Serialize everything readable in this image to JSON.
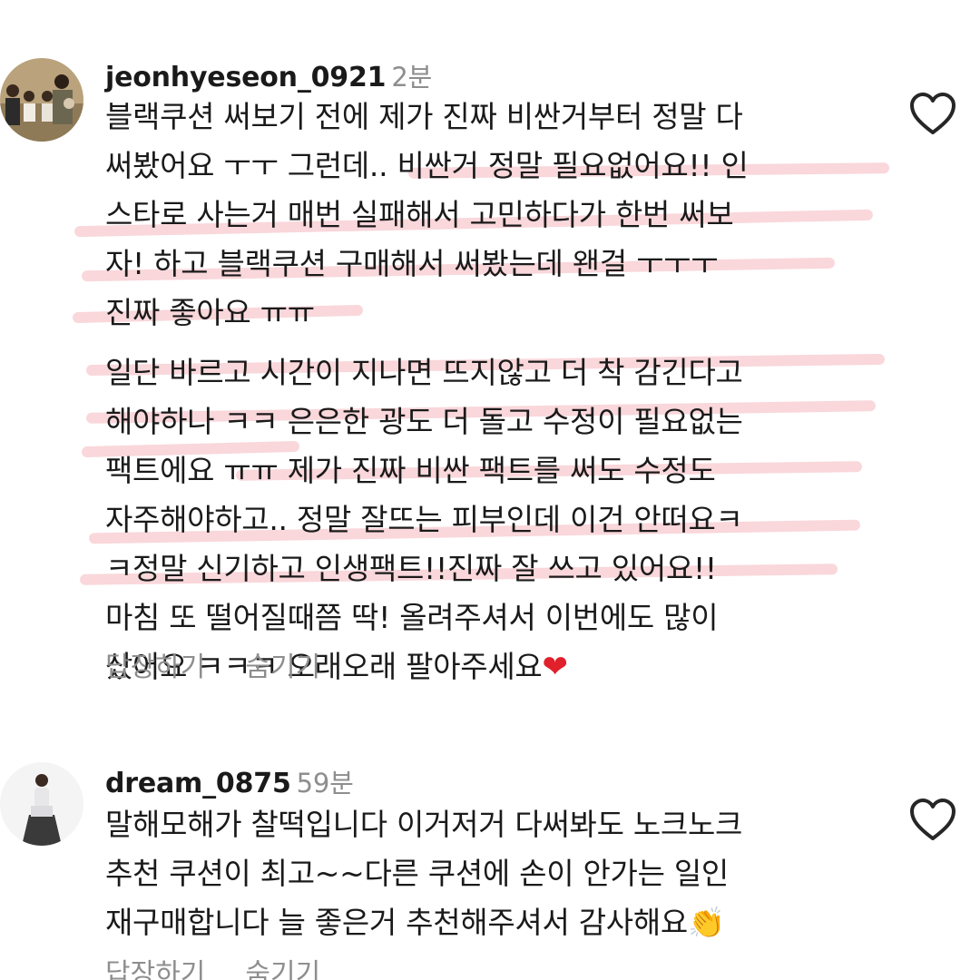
{
  "comments": [
    {
      "username": "jeonhyeseon_0921",
      "time": "2분",
      "lines": [
        "블랙쿠션 써보기 전에 제가 진짜 비싼거부터 정말 다",
        "써봤어요 ㅜㅜ 그런데.. 비싼거 정말 필요없어요!! 인",
        "스타로 사는거 매번 실패해서 고민하다가 한번 써보",
        "자! 하고 블랙쿠션 구매해서 써봤는데 왠걸 ㅜㅜㅜ",
        "진짜 좋아요 ㅠㅠ",
        "일단 바르고 시간이 지나면 뜨지않고 더 착 감긴다고",
        "해야하나 ㅋㅋ 은은한 광도 더 돌고 수정이 필요없는",
        "팩트에요 ㅠㅠ 제가 진짜 비싼 팩트를 써도 수정도",
        "자주해야하고.. 정말 잘뜨는 피부인데 이건 안떠요ㅋ",
        "ㅋ정말 신기하고 인생팩트!!진짜 잘 쓰고 있어요!!",
        "마침 또 떨어질때쯤 딱! 올려주셔서 이번에도 많이",
        "샀어요 ㅋㅋㅋ 오래오래 팔아주세요"
      ],
      "emoji": "❤",
      "reply_label": "답장하기",
      "hide_label": "숨기기"
    },
    {
      "username": "dream_0875",
      "time": "59분",
      "lines": [
        "말해모해가 찰떡입니다 이거저거 다써봐도 노크노크",
        "추천 쿠션이 최고~~다른 쿠션에 손이 안가는 일인",
        "재구매합니다 늘 좋은거 추천해주셔서 감사해요"
      ],
      "emoji": "👏",
      "reply_label": "답장하기",
      "hide_label": "숨기기"
    }
  ]
}
